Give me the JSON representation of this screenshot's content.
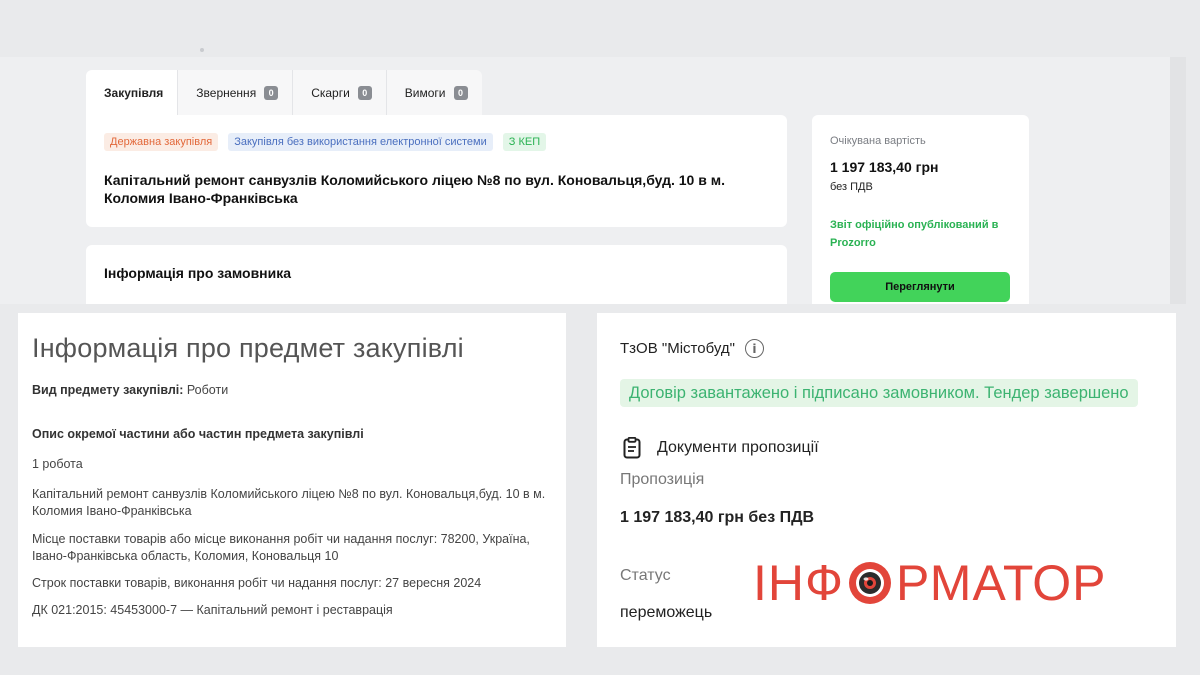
{
  "tabs": [
    {
      "label": "Закупівля"
    },
    {
      "label": "Звернення",
      "count": "0"
    },
    {
      "label": "Скарги",
      "count": "0"
    },
    {
      "label": "Вимоги",
      "count": "0"
    }
  ],
  "tender": {
    "tags": [
      "Державна закупівля",
      "Закупівля без використання електронної системи",
      "З КЕП"
    ],
    "title": "Капітальний ремонт санвузлів Коломийського ліцею №8 по вул. Коновальця,буд. 10 в м. Коломия Івано-Франківська",
    "customer_heading": "Інформація про замовника"
  },
  "side": {
    "expected_label": "Очікувана вартість",
    "amount": "1 197 183,40 грн",
    "vat": "без ПДВ",
    "report": "Звіт офіційно опублікований в Prozorro",
    "button": "Переглянути"
  },
  "subject": {
    "title": "Інформація про предмет закупівлі",
    "type_label": "Вид предмету закупівлі:",
    "type_value": " Роботи",
    "part_heading": "Опис окремої частини або частин предмета закупівлі",
    "quantity": "1 робота",
    "description": "Капітальний ремонт санвузлів Коломийського ліцею №8 по вул. Коновальця,буд. 10 в м. Коломия Івано-Франківська",
    "delivery_place": "Місце поставки товарів або місце виконання робіт чи надання послуг: 78200, Україна, Івано-Франківська область, Коломия, Коновальця 10",
    "delivery_term": "Строк поставки товарів, виконання робіт чи надання послуг: 27 вересня 2024",
    "classifier": "ДК 021:2015: 45453000-7 — Капітальний ремонт і реставрація"
  },
  "winner": {
    "name": "ТзОВ \"Містобуд\"",
    "banner": "Договір завантажено і підписано замовником. Тендер завершено",
    "docs_label": "Документи пропозиції",
    "proposal_label": "Пропозиція",
    "proposal_value": "1 197 183,40 грн без ПДВ",
    "status_label": "Статус",
    "status_value": "переможець"
  },
  "logo": {
    "left": "ІНФ",
    "right": "РМАТОР"
  },
  "colors": {
    "accent_green": "#42d35a",
    "logo_red": "#e2453a",
    "tag_orange": "#e2683a",
    "tag_blue": "#4a6fbf"
  }
}
